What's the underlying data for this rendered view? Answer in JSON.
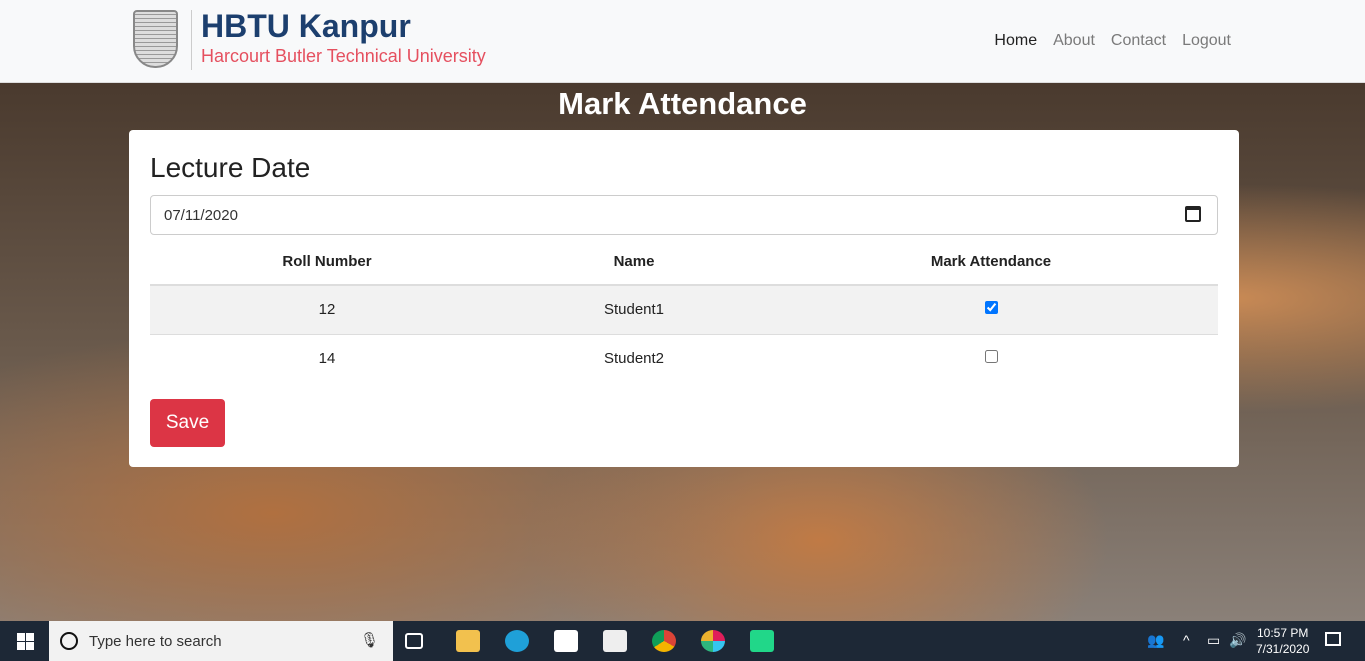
{
  "header": {
    "title": "HBTU Kanpur",
    "subtitle": "Harcourt Butler Technical  University",
    "nav": [
      "Home",
      "About",
      "Contact",
      "Logout"
    ]
  },
  "page_title": "Mark Attendance",
  "form": {
    "date_label": "Lecture Date",
    "date_value": "07/11/2020",
    "save_label": "Save",
    "columns": [
      "Roll Number",
      "Name",
      "Mark Attendance"
    ],
    "rows": [
      {
        "roll": "12",
        "name": "Student1",
        "present": true
      },
      {
        "roll": "14",
        "name": "Student2",
        "present": false
      }
    ]
  },
  "taskbar": {
    "search_placeholder": "Type here to search",
    "time": "10:57 PM",
    "date": "7/31/2020"
  }
}
